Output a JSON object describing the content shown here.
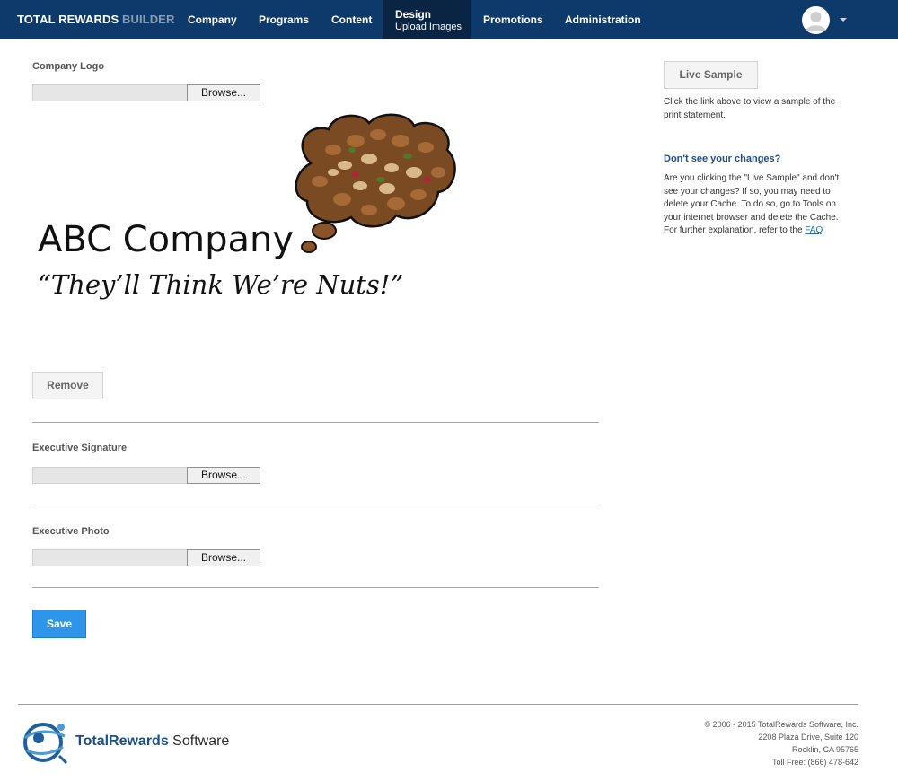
{
  "nav": {
    "brand_main": "TOTAL REWARDS",
    "brand_sub": " BUILDER",
    "items": [
      {
        "label": "Company"
      },
      {
        "label": "Programs"
      },
      {
        "label": "Content"
      },
      {
        "label": "Design",
        "sub": "Upload Images",
        "active": true
      },
      {
        "label": "Promotions"
      },
      {
        "label": "Administration"
      }
    ],
    "avatar_icon": "user-avatar-icon",
    "menu_caret": "caret-down-icon"
  },
  "main": {
    "company_logo": {
      "label": "Company Logo",
      "browse_label": "Browse...",
      "preview": {
        "company_name": "ABC Company",
        "tagline": "“They’ll Think We’re Nuts!”"
      },
      "remove_label": "Remove"
    },
    "executive_signature": {
      "label": "Executive Signature",
      "browse_label": "Browse..."
    },
    "executive_photo": {
      "label": "Executive Photo",
      "browse_label": "Browse..."
    },
    "save_label": "Save"
  },
  "sidebar": {
    "live_sample_label": "Live Sample",
    "live_sample_text": "Click the link above to view a sample of the print statement.",
    "heading": "Don't see your changes?",
    "body": "Are you clicking the \"Live Sample\" and don't see your changes? If so, you may need to delete your Cache. To do so, go to Tools on your internet browser and delete the Cache. For further explanation, refer to the ",
    "faq_label": "FAQ"
  },
  "footer": {
    "logo_name": "TotalRewards",
    "logo_suffix": " Software",
    "copyright": "© 2006 - 2015 TotalRewards Software, Inc.",
    "address1": "2208 Plaza Drive, Suite 120",
    "address2": "Rocklin, CA 95765",
    "phone": "Toll Free: (866) 478-642"
  },
  "colors": {
    "nav_bg": "#0e3a6b",
    "nav_active_bg": "#0a2543",
    "save_button": "#2f95ea",
    "side_heading": "#1c4e86"
  }
}
